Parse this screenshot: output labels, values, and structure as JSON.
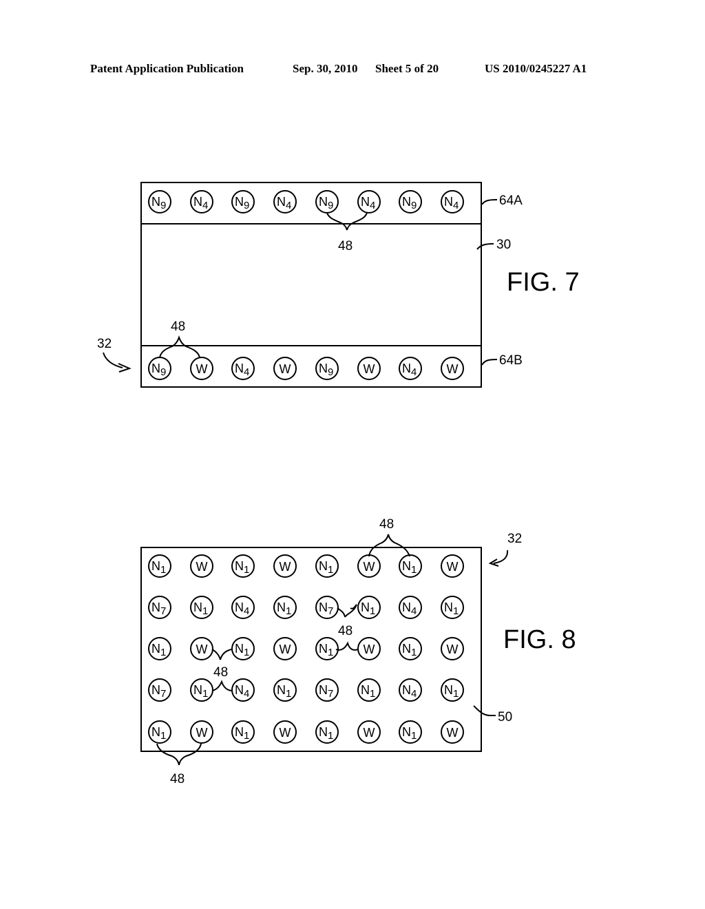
{
  "header": {
    "left": "Patent Application Publication",
    "date": "Sep. 30, 2010",
    "sheet": "Sheet 5 of 20",
    "number": "US 2010/0245227 A1"
  },
  "fig7": {
    "label": "FIG. 7",
    "refs": {
      "top_layer": "64A",
      "substrate": "30",
      "bottom_layer": "64B",
      "device": "32",
      "pair_top": "48",
      "pair_bottom": "48"
    },
    "top_row": [
      {
        "base": "N",
        "sub": "9"
      },
      {
        "base": "N",
        "sub": "4"
      },
      {
        "base": "N",
        "sub": "9"
      },
      {
        "base": "N",
        "sub": "4"
      },
      {
        "base": "N",
        "sub": "9"
      },
      {
        "base": "N",
        "sub": "4"
      },
      {
        "base": "N",
        "sub": "9"
      },
      {
        "base": "N",
        "sub": "4"
      }
    ],
    "bottom_row": [
      {
        "base": "N",
        "sub": "9"
      },
      {
        "base": "W",
        "sub": ""
      },
      {
        "base": "N",
        "sub": "4"
      },
      {
        "base": "W",
        "sub": ""
      },
      {
        "base": "N",
        "sub": "9"
      },
      {
        "base": "W",
        "sub": ""
      },
      {
        "base": "N",
        "sub": "4"
      },
      {
        "base": "W",
        "sub": ""
      }
    ]
  },
  "fig8": {
    "label": "FIG. 8",
    "refs": {
      "device": "32",
      "substrate": "50",
      "pair_top": "48",
      "pair_row2": "48",
      "pair_row3": "48",
      "pair_bottom": "48"
    },
    "rows": [
      [
        {
          "base": "N",
          "sub": "1"
        },
        {
          "base": "W",
          "sub": ""
        },
        {
          "base": "N",
          "sub": "1"
        },
        {
          "base": "W",
          "sub": ""
        },
        {
          "base": "N",
          "sub": "1"
        },
        {
          "base": "W",
          "sub": ""
        },
        {
          "base": "N",
          "sub": "1"
        },
        {
          "base": "W",
          "sub": ""
        }
      ],
      [
        {
          "base": "N",
          "sub": "7"
        },
        {
          "base": "N",
          "sub": "1"
        },
        {
          "base": "N",
          "sub": "4"
        },
        {
          "base": "N",
          "sub": "1"
        },
        {
          "base": "N",
          "sub": "7"
        },
        {
          "base": "N",
          "sub": "1"
        },
        {
          "base": "N",
          "sub": "4"
        },
        {
          "base": "N",
          "sub": "1"
        }
      ],
      [
        {
          "base": "N",
          "sub": "1"
        },
        {
          "base": "W",
          "sub": ""
        },
        {
          "base": "N",
          "sub": "1"
        },
        {
          "base": "W",
          "sub": ""
        },
        {
          "base": "N",
          "sub": "1"
        },
        {
          "base": "W",
          "sub": ""
        },
        {
          "base": "N",
          "sub": "1"
        },
        {
          "base": "W",
          "sub": ""
        }
      ],
      [
        {
          "base": "N",
          "sub": "7"
        },
        {
          "base": "N",
          "sub": "1"
        },
        {
          "base": "N",
          "sub": "4"
        },
        {
          "base": "N",
          "sub": "1"
        },
        {
          "base": "N",
          "sub": "7"
        },
        {
          "base": "N",
          "sub": "1"
        },
        {
          "base": "N",
          "sub": "4"
        },
        {
          "base": "N",
          "sub": "1"
        }
      ],
      [
        {
          "base": "N",
          "sub": "1"
        },
        {
          "base": "W",
          "sub": ""
        },
        {
          "base": "N",
          "sub": "1"
        },
        {
          "base": "W",
          "sub": ""
        },
        {
          "base": "N",
          "sub": "1"
        },
        {
          "base": "W",
          "sub": ""
        },
        {
          "base": "N",
          "sub": "1"
        },
        {
          "base": "W",
          "sub": ""
        }
      ]
    ]
  }
}
